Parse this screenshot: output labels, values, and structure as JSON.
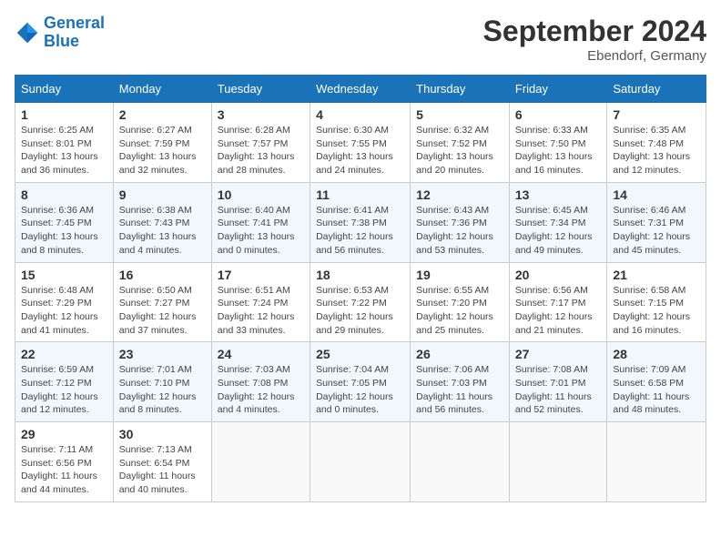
{
  "header": {
    "logo_line1": "General",
    "logo_line2": "Blue",
    "month": "September 2024",
    "location": "Ebendorf, Germany"
  },
  "weekdays": [
    "Sunday",
    "Monday",
    "Tuesday",
    "Wednesday",
    "Thursday",
    "Friday",
    "Saturday"
  ],
  "weeks": [
    [
      {
        "day": "1",
        "sunrise": "Sunrise: 6:25 AM",
        "sunset": "Sunset: 8:01 PM",
        "daylight": "Daylight: 13 hours and 36 minutes."
      },
      {
        "day": "2",
        "sunrise": "Sunrise: 6:27 AM",
        "sunset": "Sunset: 7:59 PM",
        "daylight": "Daylight: 13 hours and 32 minutes."
      },
      {
        "day": "3",
        "sunrise": "Sunrise: 6:28 AM",
        "sunset": "Sunset: 7:57 PM",
        "daylight": "Daylight: 13 hours and 28 minutes."
      },
      {
        "day": "4",
        "sunrise": "Sunrise: 6:30 AM",
        "sunset": "Sunset: 7:55 PM",
        "daylight": "Daylight: 13 hours and 24 minutes."
      },
      {
        "day": "5",
        "sunrise": "Sunrise: 6:32 AM",
        "sunset": "Sunset: 7:52 PM",
        "daylight": "Daylight: 13 hours and 20 minutes."
      },
      {
        "day": "6",
        "sunrise": "Sunrise: 6:33 AM",
        "sunset": "Sunset: 7:50 PM",
        "daylight": "Daylight: 13 hours and 16 minutes."
      },
      {
        "day": "7",
        "sunrise": "Sunrise: 6:35 AM",
        "sunset": "Sunset: 7:48 PM",
        "daylight": "Daylight: 13 hours and 12 minutes."
      }
    ],
    [
      {
        "day": "8",
        "sunrise": "Sunrise: 6:36 AM",
        "sunset": "Sunset: 7:45 PM",
        "daylight": "Daylight: 13 hours and 8 minutes."
      },
      {
        "day": "9",
        "sunrise": "Sunrise: 6:38 AM",
        "sunset": "Sunset: 7:43 PM",
        "daylight": "Daylight: 13 hours and 4 minutes."
      },
      {
        "day": "10",
        "sunrise": "Sunrise: 6:40 AM",
        "sunset": "Sunset: 7:41 PM",
        "daylight": "Daylight: 13 hours and 0 minutes."
      },
      {
        "day": "11",
        "sunrise": "Sunrise: 6:41 AM",
        "sunset": "Sunset: 7:38 PM",
        "daylight": "Daylight: 12 hours and 56 minutes."
      },
      {
        "day": "12",
        "sunrise": "Sunrise: 6:43 AM",
        "sunset": "Sunset: 7:36 PM",
        "daylight": "Daylight: 12 hours and 53 minutes."
      },
      {
        "day": "13",
        "sunrise": "Sunrise: 6:45 AM",
        "sunset": "Sunset: 7:34 PM",
        "daylight": "Daylight: 12 hours and 49 minutes."
      },
      {
        "day": "14",
        "sunrise": "Sunrise: 6:46 AM",
        "sunset": "Sunset: 7:31 PM",
        "daylight": "Daylight: 12 hours and 45 minutes."
      }
    ],
    [
      {
        "day": "15",
        "sunrise": "Sunrise: 6:48 AM",
        "sunset": "Sunset: 7:29 PM",
        "daylight": "Daylight: 12 hours and 41 minutes."
      },
      {
        "day": "16",
        "sunrise": "Sunrise: 6:50 AM",
        "sunset": "Sunset: 7:27 PM",
        "daylight": "Daylight: 12 hours and 37 minutes."
      },
      {
        "day": "17",
        "sunrise": "Sunrise: 6:51 AM",
        "sunset": "Sunset: 7:24 PM",
        "daylight": "Daylight: 12 hours and 33 minutes."
      },
      {
        "day": "18",
        "sunrise": "Sunrise: 6:53 AM",
        "sunset": "Sunset: 7:22 PM",
        "daylight": "Daylight: 12 hours and 29 minutes."
      },
      {
        "day": "19",
        "sunrise": "Sunrise: 6:55 AM",
        "sunset": "Sunset: 7:20 PM",
        "daylight": "Daylight: 12 hours and 25 minutes."
      },
      {
        "day": "20",
        "sunrise": "Sunrise: 6:56 AM",
        "sunset": "Sunset: 7:17 PM",
        "daylight": "Daylight: 12 hours and 21 minutes."
      },
      {
        "day": "21",
        "sunrise": "Sunrise: 6:58 AM",
        "sunset": "Sunset: 7:15 PM",
        "daylight": "Daylight: 12 hours and 16 minutes."
      }
    ],
    [
      {
        "day": "22",
        "sunrise": "Sunrise: 6:59 AM",
        "sunset": "Sunset: 7:12 PM",
        "daylight": "Daylight: 12 hours and 12 minutes."
      },
      {
        "day": "23",
        "sunrise": "Sunrise: 7:01 AM",
        "sunset": "Sunset: 7:10 PM",
        "daylight": "Daylight: 12 hours and 8 minutes."
      },
      {
        "day": "24",
        "sunrise": "Sunrise: 7:03 AM",
        "sunset": "Sunset: 7:08 PM",
        "daylight": "Daylight: 12 hours and 4 minutes."
      },
      {
        "day": "25",
        "sunrise": "Sunrise: 7:04 AM",
        "sunset": "Sunset: 7:05 PM",
        "daylight": "Daylight: 12 hours and 0 minutes."
      },
      {
        "day": "26",
        "sunrise": "Sunrise: 7:06 AM",
        "sunset": "Sunset: 7:03 PM",
        "daylight": "Daylight: 11 hours and 56 minutes."
      },
      {
        "day": "27",
        "sunrise": "Sunrise: 7:08 AM",
        "sunset": "Sunset: 7:01 PM",
        "daylight": "Daylight: 11 hours and 52 minutes."
      },
      {
        "day": "28",
        "sunrise": "Sunrise: 7:09 AM",
        "sunset": "Sunset: 6:58 PM",
        "daylight": "Daylight: 11 hours and 48 minutes."
      }
    ],
    [
      {
        "day": "29",
        "sunrise": "Sunrise: 7:11 AM",
        "sunset": "Sunset: 6:56 PM",
        "daylight": "Daylight: 11 hours and 44 minutes."
      },
      {
        "day": "30",
        "sunrise": "Sunrise: 7:13 AM",
        "sunset": "Sunset: 6:54 PM",
        "daylight": "Daylight: 11 hours and 40 minutes."
      },
      null,
      null,
      null,
      null,
      null
    ]
  ]
}
